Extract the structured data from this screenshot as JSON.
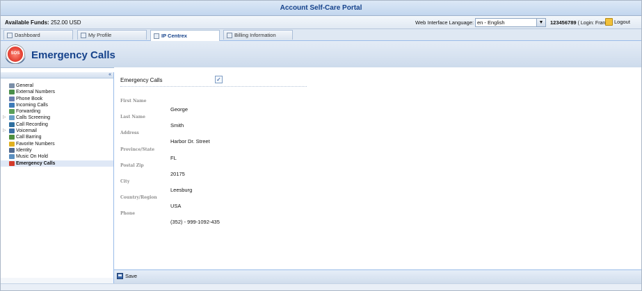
{
  "app": {
    "title": "Account Self-Care Portal"
  },
  "info": {
    "funds_label": "Available Funds:",
    "funds_value": "252.00 USD",
    "language_label": "Web Interface Language:",
    "language_value": "en - English",
    "account_id": "123456789",
    "login_text": "( Login: Frank )",
    "logout_label": "Logout"
  },
  "tabs": [
    {
      "label": "Dashboard",
      "icon": "dashboard-icon"
    },
    {
      "label": "My Profile",
      "icon": "users-icon"
    },
    {
      "label": "IP Centrex",
      "icon": "gear-icon",
      "active": true
    },
    {
      "label": "Billing Information",
      "icon": "document-icon"
    }
  ],
  "header": {
    "title": "Emergency Calls",
    "icon": "sos-phone-icon"
  },
  "sidebar": {
    "collapse_label": "«",
    "items": [
      {
        "label": "General",
        "color": "#7b8fa8"
      },
      {
        "label": "External Numbers",
        "color": "#4a8f4a"
      },
      {
        "label": "Phone Book",
        "color": "#6b7fb0"
      },
      {
        "label": "Incoming Calls",
        "color": "#3e7bb8"
      },
      {
        "label": "Forwarding",
        "color": "#5aa05a"
      },
      {
        "label": "Calls Screening",
        "color": "#6aa0c8",
        "expandable": true
      },
      {
        "label": "Call Recording",
        "color": "#2f6f9f"
      },
      {
        "label": "Voicemail",
        "color": "#3b6fa6",
        "expandable": true
      },
      {
        "label": "Call Barring",
        "color": "#4f8f3f"
      },
      {
        "label": "Favorite Numbers",
        "color": "#e0b020"
      },
      {
        "label": "Identity",
        "color": "#506a90"
      },
      {
        "label": "Music On Hold",
        "color": "#5b8fc0"
      },
      {
        "label": "Emergency Calls",
        "color": "#d43a2a",
        "active": true
      }
    ]
  },
  "main": {
    "emergency_label": "Emergency Calls",
    "emergency_checked": true,
    "check_mark": "✓",
    "fields": [
      {
        "label": "First Name",
        "value": "George"
      },
      {
        "label": "Last Name",
        "value": "Smith"
      },
      {
        "label": "Address",
        "value": "Harbor Dr. Street"
      },
      {
        "label": "Province/State",
        "value": "FL"
      },
      {
        "label": "Postal Zip",
        "value": "20175"
      },
      {
        "label": "City",
        "value": "Leesburg"
      },
      {
        "label": "Country/Region",
        "value": "USA"
      },
      {
        "label": "Phone",
        "value": "(352) - 999-1092-435"
      }
    ]
  },
  "toolbar": {
    "save_label": "Save"
  }
}
